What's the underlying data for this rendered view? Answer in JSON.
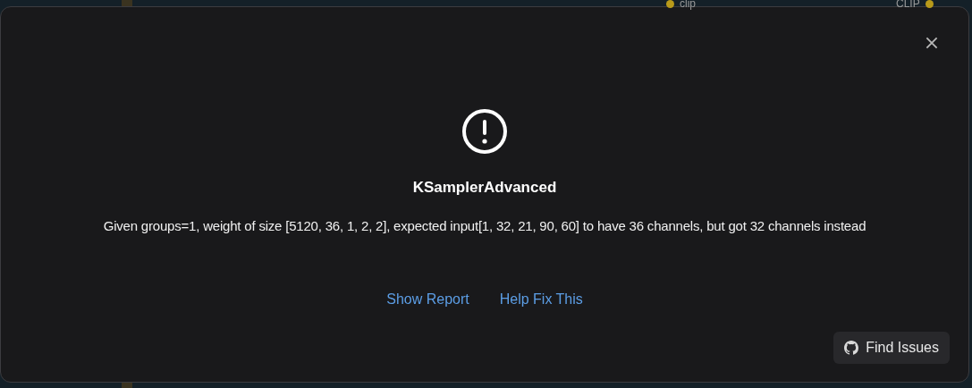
{
  "canvas": {
    "inputs": [
      {
        "label": "clip"
      },
      {
        "label": "CLIP"
      }
    ]
  },
  "dialog": {
    "title": "KSamplerAdvanced",
    "message": "Given groups=1, weight of size [5120, 36, 1, 2, 2], expected input[1, 32, 21, 90, 60] to have 36 channels, but got 32 channels instead",
    "links": [
      "Show Report",
      "Help Fix This"
    ],
    "button": "Find Issues"
  }
}
